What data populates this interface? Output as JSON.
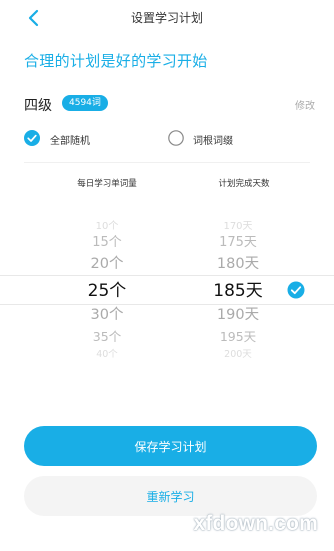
{
  "header": {
    "title": "设置学习计划"
  },
  "slogan": "合理的计划是好的学习开始",
  "level": {
    "name": "四级",
    "badge": "4594词",
    "edit_label": "修改"
  },
  "options": [
    {
      "label": "全部随机",
      "selected": true
    },
    {
      "label": "词根词缀",
      "selected": false
    }
  ],
  "picker": {
    "daily_header": "每日学习单词量",
    "days_header": "计划完成天数",
    "daily_values": [
      "10个",
      "15个",
      "20个",
      "25个",
      "30个",
      "35个",
      "40个"
    ],
    "days_values": [
      "170天",
      "175天",
      "180天",
      "185天",
      "190天",
      "195天",
      "200天"
    ],
    "selected_daily": "25个",
    "selected_days": "185天"
  },
  "buttons": {
    "save": "保存学习计划",
    "restart": "重新学习"
  },
  "watermark": "xfdown.com",
  "colors": {
    "accent": "#19aee6",
    "secondary_bg": "#f4f4f4"
  },
  "icons": {
    "back": "chevron-left-icon",
    "checked": "check-circle-icon",
    "unchecked": "radio-empty-icon"
  }
}
